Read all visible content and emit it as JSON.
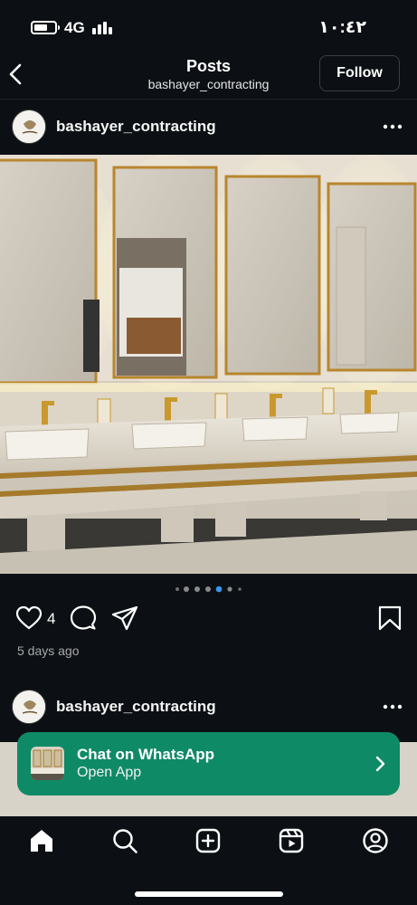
{
  "status_bar": {
    "network": "4G",
    "time": "١٠:٤٢",
    "icons": [
      "battery-icon",
      "signal-bars-icon"
    ]
  },
  "header": {
    "title": "Posts",
    "subtitle": "bashayer_contracting",
    "follow_label": "Follow",
    "icons": [
      "back-chevron-icon"
    ]
  },
  "post": {
    "username": "bashayer_contracting",
    "image_icon": "bathroom-vanity-photo",
    "carousel": {
      "count": 6,
      "active": 4
    },
    "likes": "4",
    "timestamp": "5 days ago",
    "icons": [
      "heart-icon",
      "comment-icon",
      "share-icon",
      "bookmark-icon",
      "more-icon"
    ]
  },
  "next_post": {
    "username": "bashayer_contracting"
  },
  "whatsapp_banner": {
    "title": "Chat on WhatsApp",
    "subtitle": "Open App",
    "background": "#0f8a67"
  },
  "bottom_nav": {
    "items": [
      "home-icon",
      "search-icon",
      "create-icon",
      "reels-icon",
      "profile-icon"
    ]
  },
  "colors": {
    "background": "#0c1014",
    "active_dot": "#3797f0",
    "text_secondary": "#a8a8a8"
  }
}
